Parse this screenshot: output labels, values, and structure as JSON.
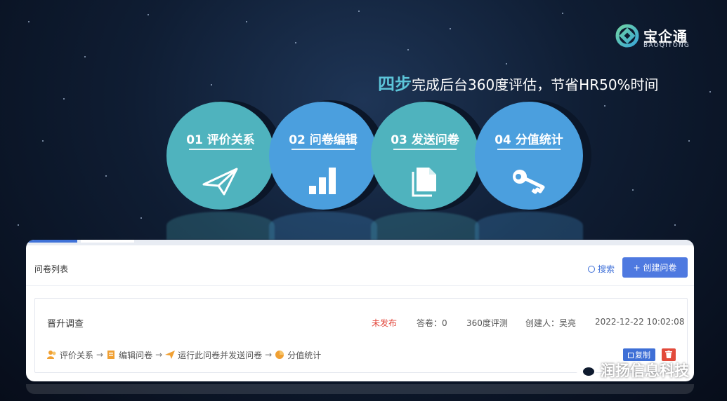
{
  "brand": {
    "name": "宝企通",
    "subtitle": "BAOQITONG"
  },
  "headline": {
    "emphasis": "四步",
    "rest": "完成后台360度评估，节省HR50%时间"
  },
  "steps": [
    {
      "label": "01 评价关系",
      "icon": "paper-plane-icon",
      "color": "#4fb3be"
    },
    {
      "label": "02 问卷编辑",
      "icon": "bar-chart-icon",
      "color": "#4b9fde"
    },
    {
      "label": "03 发送问卷",
      "icon": "document-icon",
      "color": "#4fb3be"
    },
    {
      "label": "04 分值统计",
      "icon": "key-icon",
      "color": "#4b9fde"
    }
  ],
  "panel": {
    "title": "问卷列表",
    "search_label": "搜索",
    "create_label": "+ 创建问卷",
    "survey": {
      "name": "晋升调查",
      "status": "未发布",
      "responses": "答卷：0",
      "type": "360度评测",
      "creator": "创建人：吴亮",
      "created_at": "2022-12-22 10:02:08",
      "flow": [
        "评价关系",
        "编辑问卷",
        "运行此问卷并发送问卷",
        "分值统计"
      ],
      "copy_label": "复制"
    }
  },
  "watermark": "润扬信息科技",
  "colors": {
    "accent": "#4e79e0",
    "teal": "#4fb3be",
    "blue": "#4b9fde",
    "danger": "#e24a3b",
    "headline_emphasis": "#5cc4d8"
  }
}
